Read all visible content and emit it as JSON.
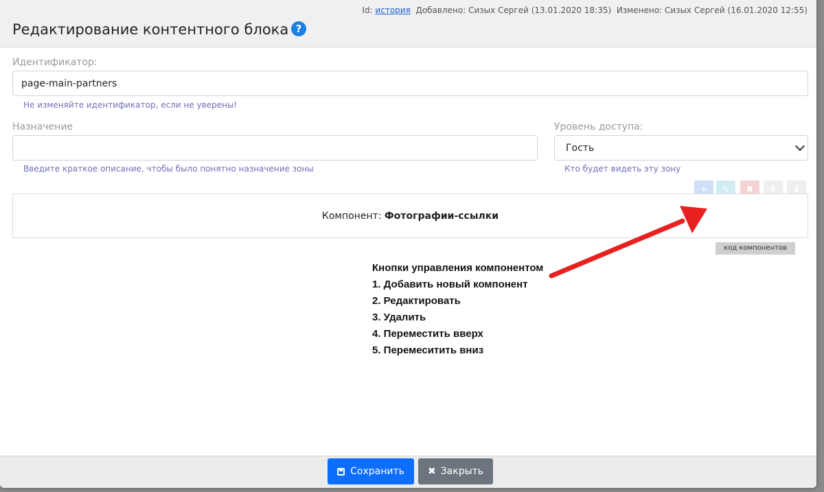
{
  "header": {
    "title": "Редактирование контентного блока",
    "help_icon": "?",
    "meta_id_label": "Id:",
    "meta_id_link": "история",
    "meta_added": "Добавлено: Сизых Сергей (13.01.2020 18:35)",
    "meta_changed": "Изменено: Сизых Сергей (16.01.2020 12:55)"
  },
  "form": {
    "identifier_label": "Идентификатор:",
    "identifier_value": "page-main-partners",
    "identifier_hint": "Не изменяйте идентификатор, если не уверены!",
    "purpose_label": "Назначение",
    "purpose_value": "",
    "purpose_hint": "Введите краткое описание, чтобы было понятно назначение зоны",
    "access_label": "Уровень доступа:",
    "access_value": "Гость",
    "access_hint": "Кто будет видеть эту зону"
  },
  "component": {
    "label": "Компонент:",
    "name": "Фотографии-ссылки",
    "code_button": "код компонентов",
    "controls": [
      {
        "icon": "plus-icon",
        "glyph": "+",
        "color": "#cfe0f8"
      },
      {
        "icon": "pencil-icon",
        "glyph": "✎",
        "color": "#d2ecf3"
      },
      {
        "icon": "times-icon",
        "glyph": "✖",
        "color": "#f6d3d3"
      },
      {
        "icon": "arrow-up-icon",
        "glyph": "⬆",
        "color": "#efefef"
      },
      {
        "icon": "arrow-down-icon",
        "glyph": "⬇",
        "color": "#efefef"
      }
    ]
  },
  "annotation": {
    "title": "Кнопки управления компонентом",
    "items": [
      "1. Добавить новый компонент",
      "2. Редактировать",
      "3. Удалить",
      "4. Переместить вверх",
      "5. Перемеситить вниз"
    ],
    "arrow_color": "#e82020"
  },
  "footer": {
    "save_label": "Сохранить",
    "save_icon": "floppy-icon",
    "close_label": "Закрыть",
    "close_icon": "times-icon",
    "save_color": "#0d6efd",
    "close_color": "#6c757d"
  }
}
